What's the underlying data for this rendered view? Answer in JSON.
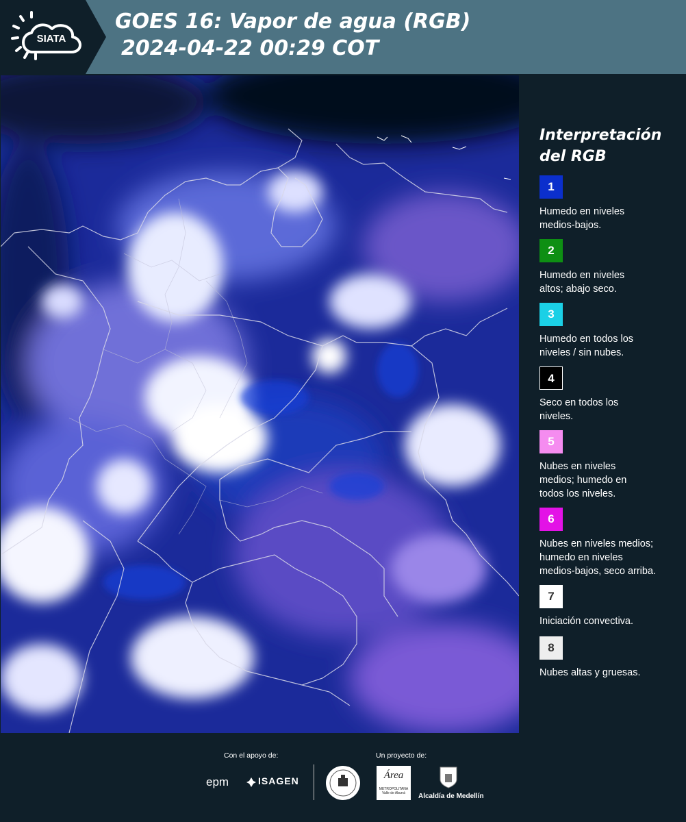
{
  "header": {
    "logo_text": "SIATA",
    "title_line1": "GOES 16: Vapor de agua (RGB)",
    "title_line2": "2024-04-22 00:29 COT"
  },
  "legend": {
    "title_line1": "Interpretación",
    "title_line2": "del RGB",
    "items": [
      {
        "number": "1",
        "color": "#0b2fcc",
        "description": [
          "Humedo en niveles",
          "medios-bajos."
        ]
      },
      {
        "number": "2",
        "color": "#0e8f13",
        "description": [
          "Humedo en niveles",
          "altos; abajo seco."
        ]
      },
      {
        "number": "3",
        "color": "#1bd0e6",
        "description": [
          "Humedo en todos los",
          "niveles / sin nubes."
        ]
      },
      {
        "number": "4",
        "color": "#000000",
        "description": [
          "Seco en todos los",
          "niveles."
        ]
      },
      {
        "number": "5",
        "color": "#f58cf0",
        "description": [
          "Nubes en niveles",
          "medios; humedo en",
          "todos los niveles."
        ]
      },
      {
        "number": "6",
        "color": "#e312e6",
        "description": [
          "Nubes en niveles medios;",
          "humedo en niveles",
          "medios-bajos, seco arriba."
        ]
      },
      {
        "number": "7",
        "color": "#ffffff",
        "description": [
          "Iniciación convectiva."
        ]
      },
      {
        "number": "8",
        "color": "#eeeeee",
        "description": [
          "Nubes altas y gruesas."
        ]
      }
    ]
  },
  "footer": {
    "support_caption": "Con el apoyo de:",
    "project_caption": "Un proyecto de:",
    "sponsors": [
      "epm",
      "ISAGEN"
    ],
    "partner_area_main": "Área",
    "partner_area_sub1": "METROPOLITANA",
    "partner_area_sub2": "Valle de Aburrá",
    "partner_alcaldia": "Alcaldía de Medellín"
  }
}
